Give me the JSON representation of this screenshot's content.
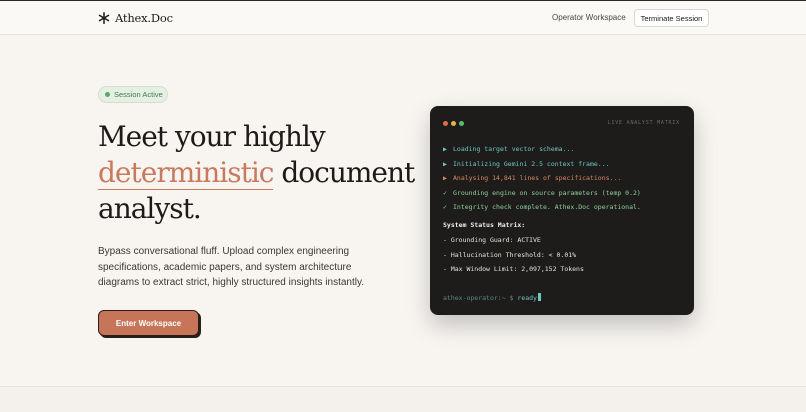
{
  "brand": {
    "name": "Athex.Doc",
    "icon": "asterisk-icon"
  },
  "nav": {
    "workspace_link": "Operator Workspace",
    "terminate_button": "Terminate Session"
  },
  "badge": {
    "label": "Session Active",
    "color": "#5aa86a"
  },
  "hero": {
    "headline_part1": "Meet your highly",
    "headline_accent": "deterministic",
    "headline_part2": "document analyst.",
    "accent_color": "#c87a5e",
    "lede": "Bypass conversational fluff. Upload complex engineering specifications, academic papers, and system architecture diagrams to extract strict, highly structured insights instantly.",
    "cta_label": "Enter Workspace"
  },
  "terminal": {
    "title": "LIVE ANALYST MATRIX",
    "log": [
      {
        "icon": "▶",
        "text": "Loading target vector schema...",
        "tone": "teal"
      },
      {
        "icon": "▶",
        "text": "Initializing Gemini 2.5 context frame...",
        "tone": "teal"
      },
      {
        "icon": "▶",
        "text": "Analysing 14,841 lines of specifications...",
        "tone": "orange"
      },
      {
        "icon": "✓",
        "text": "Grounding engine on source parameters (temp 0.2)",
        "tone": "green"
      },
      {
        "icon": "✓",
        "text": "Integrity check complete. Athex.Doc operational.",
        "tone": "green"
      }
    ],
    "status_heading": "System Status Matrix:",
    "status": [
      "- Grounding Guard: ACTIVE",
      "- Hallucination Threshold: < 0.01%",
      "- Max Window Limit: 2,097,152 Tokens"
    ],
    "prompt": "athex-operator:~ $",
    "command": "ready"
  }
}
